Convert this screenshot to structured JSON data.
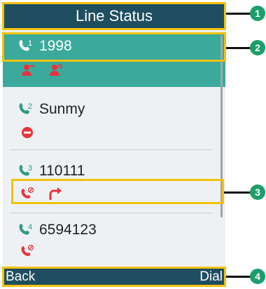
{
  "title": "Line Status",
  "lines": [
    {
      "number": "1",
      "label": "1998"
    },
    {
      "number": "2",
      "label": "Sunmy"
    },
    {
      "number": "3",
      "label": "110111"
    },
    {
      "number": "4",
      "label": "6594123"
    }
  ],
  "softkeys": {
    "left": "Back",
    "right": "Dial"
  },
  "callouts": [
    "1",
    "2",
    "3",
    "4"
  ],
  "colors": {
    "titlebar": "#1f4e61",
    "selected_row": "#3ba99c",
    "highlight": "#f2c20b",
    "callout": "#1c9e6a",
    "status_icon": "#e8333a"
  },
  "icons": [
    "phone-line-icon",
    "contact-busy-icon",
    "dnd-icon",
    "missed-call-icon",
    "call-forward-icon"
  ]
}
